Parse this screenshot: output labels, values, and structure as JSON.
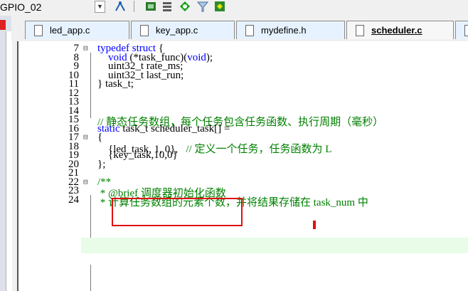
{
  "toolbar": {
    "target_label": "GPIO_02",
    "icons": [
      "dropdown-arrow-icon",
      "build-target-icon",
      "pack-installer-icon",
      "manage-components-icon",
      "debug-icon",
      "filter-icon",
      "run-icon"
    ]
  },
  "tabs": [
    {
      "label": "led_app.c",
      "active": false
    },
    {
      "label": "key_app.c",
      "active": false
    },
    {
      "label": "mydefine.h",
      "active": false
    },
    {
      "label": "scheduler.c",
      "active": true
    }
  ],
  "code_lines": [
    {
      "num": "7",
      "text": "typedef struct {"
    },
    {
      "num": "8",
      "text": "    void (*task_func)(void);"
    },
    {
      "num": "9",
      "text": "    uint32_t rate_ms;"
    },
    {
      "num": "10",
      "text": "    uint32_t last_run;"
    },
    {
      "num": "11",
      "text": "} task_t;"
    },
    {
      "num": "12",
      "text": ""
    },
    {
      "num": "13",
      "text": ""
    },
    {
      "num": "14",
      "text": ""
    },
    {
      "num": "15",
      "text": "// 静态任务数组，每个任务包含任务函数、执行周期（毫秒）"
    },
    {
      "num": "16",
      "text": "static task_t scheduler_task[] ="
    },
    {
      "num": "17",
      "text": "{"
    },
    {
      "num": "18",
      "text": "    {led_task, 1, 0},   // 定义一个任务，任务函数为 L"
    },
    {
      "num": "19",
      "text": "    {key_task,10,0}"
    },
    {
      "num": "20",
      "text": "};"
    },
    {
      "num": "21",
      "text": ""
    },
    {
      "num": "22",
      "text": "/**"
    },
    {
      "num": "23",
      "text": " * @brief 调度器初始化函数"
    },
    {
      "num": "24",
      "text": " * 计算任务数组的元素个数，并将结果存储在 task_num 中"
    }
  ],
  "colors": {
    "keyword": "#0000ff",
    "comment": "#008000",
    "annotation": "#e01010",
    "current_line": "#e8fce8"
  }
}
